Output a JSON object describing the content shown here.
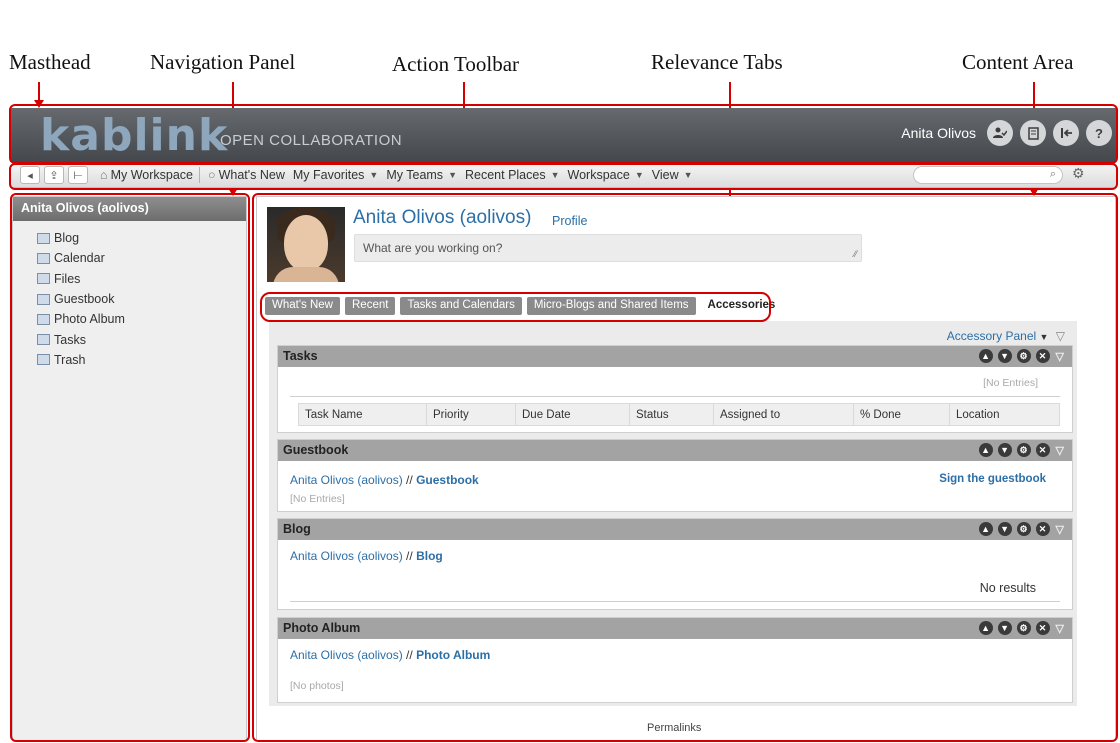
{
  "annotations": {
    "masthead": "Masthead",
    "navigation_panel": "Navigation Panel",
    "action_toolbar": "Action Toolbar",
    "relevance_tabs": "Relevance Tabs",
    "content_area": "Content Area"
  },
  "colors": {
    "accent": "#d40000",
    "link": "#2c6fa6",
    "masthead": "#4f5256"
  },
  "masthead": {
    "logo": "kablink",
    "tagline": "OPEN COLLABORATION",
    "user_name": "Anita Olivos",
    "icons": [
      "user-check-icon",
      "document-icon",
      "logout-icon",
      "help-icon"
    ],
    "help_glyph": "?"
  },
  "toolbar": {
    "icons": [
      "sidebar-toggle-icon",
      "upload-icon",
      "tree-icon"
    ],
    "items": [
      "My Workspace",
      "What's New",
      "My Favorites",
      "My Teams",
      "Recent Places",
      "Workspace",
      "View"
    ],
    "search_placeholder": ""
  },
  "nav": {
    "title": "Anita Olivos (aolivos)",
    "items": [
      {
        "label": "Blog",
        "icon": "blog-icon"
      },
      {
        "label": "Calendar",
        "icon": "calendar-icon"
      },
      {
        "label": "Files",
        "icon": "files-icon"
      },
      {
        "label": "Guestbook",
        "icon": "guestbook-icon"
      },
      {
        "label": "Photo Album",
        "icon": "photo-album-icon"
      },
      {
        "label": "Tasks",
        "icon": "tasks-icon"
      },
      {
        "label": "Trash",
        "icon": "trash-icon"
      }
    ]
  },
  "profile": {
    "name": "Anita Olivos (aolivos)",
    "profile_link": "Profile",
    "status_placeholder": "What are you working on?"
  },
  "relevance_tabs": [
    "What's New",
    "Recent",
    "Tasks and Calendars",
    "Micro-Blogs and Shared Items",
    "Accessories"
  ],
  "active_tab": "Accessories",
  "accessory_panel_label": "Accessory Panel",
  "accessories": {
    "tasks": {
      "title": "Tasks",
      "empty": "[No Entries]",
      "columns": [
        "Task Name",
        "Priority",
        "Due Date",
        "Status",
        "Assigned to",
        "% Done",
        "Location"
      ]
    },
    "guestbook": {
      "title": "Guestbook",
      "owner": "Anita Olivos (aolivos)",
      "sep": " // ",
      "link": "Guestbook",
      "action": "Sign the guestbook",
      "empty": "[No Entries]"
    },
    "blog": {
      "title": "Blog",
      "owner": "Anita Olivos (aolivos)",
      "sep": " // ",
      "link": "Blog",
      "empty": "No results"
    },
    "photo_album": {
      "title": "Photo Album",
      "owner": "Anita Olivos (aolivos)",
      "sep": " // ",
      "link": "Photo Album",
      "empty": "[No photos]"
    }
  },
  "footer": {
    "permalinks": "Permalinks"
  }
}
